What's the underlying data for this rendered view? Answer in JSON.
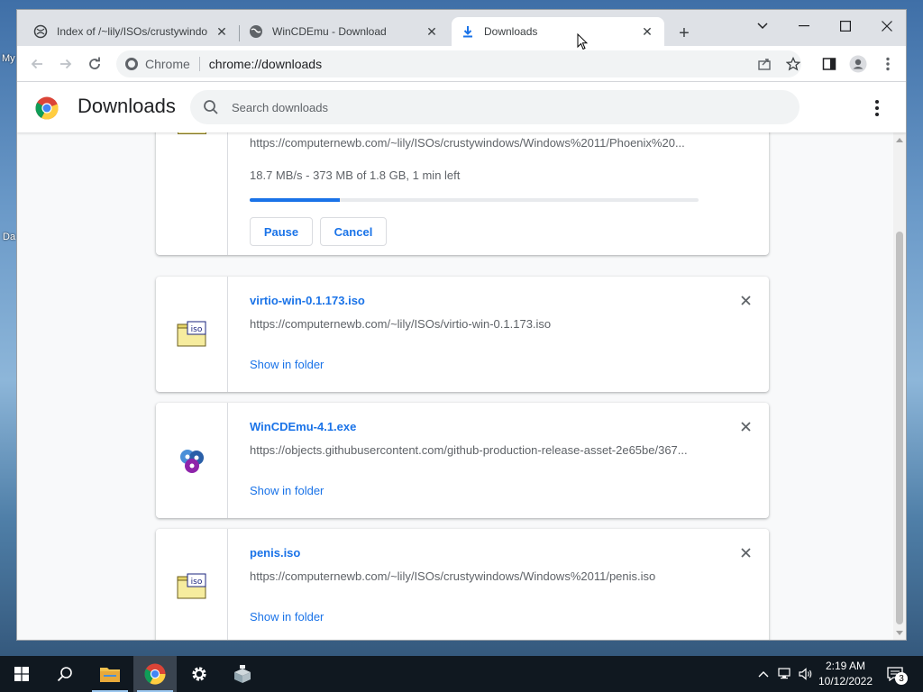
{
  "desktop": {
    "label_my": "My",
    "label_da": "Da"
  },
  "tabs": [
    {
      "title": "Index of /~lily/ISOs/crustywindo",
      "icon": "globe-icon"
    },
    {
      "title": "WinCDEmu - Download",
      "icon": "globe-icon"
    },
    {
      "title": "Downloads",
      "icon": "download-icon"
    }
  ],
  "toolbar": {
    "chip_label": "Chrome",
    "url": "chrome://downloads"
  },
  "page": {
    "title": "Downloads",
    "search_placeholder": "Search downloads"
  },
  "downloads": {
    "active": {
      "url": "https://computernewb.com/~lily/ISOs/crustywindows/Windows%2011/Phoenix%20...",
      "status": "18.7 MB/s - 373 MB of 1.8 GB, 1 min left",
      "progress": 0.2,
      "pause_label": "Pause",
      "cancel_label": "Cancel"
    },
    "items": [
      {
        "name": "virtio-win-0.1.173.iso",
        "url": "https://computernewb.com/~lily/ISOs/virtio-win-0.1.173.iso",
        "action": "Show in folder",
        "icon": "iso-file-icon"
      },
      {
        "name": "WinCDEmu-4.1.exe",
        "url": "https://objects.githubusercontent.com/github-production-release-asset-2e65be/367...",
        "action": "Show in folder",
        "icon": "wincdemu-app-icon"
      },
      {
        "name": "penis.iso",
        "url": "https://computernewb.com/~lily/ISOs/crustywindows/Windows%2011/penis.iso",
        "action": "Show in folder",
        "icon": "iso-file-icon"
      }
    ]
  },
  "taskbar": {
    "time": "2:19 AM",
    "date": "10/12/2022",
    "notification_count": "3"
  },
  "colors": {
    "accent": "#1a73e8",
    "tabstrip": "#dee1e6",
    "taskbar": "#101820"
  }
}
